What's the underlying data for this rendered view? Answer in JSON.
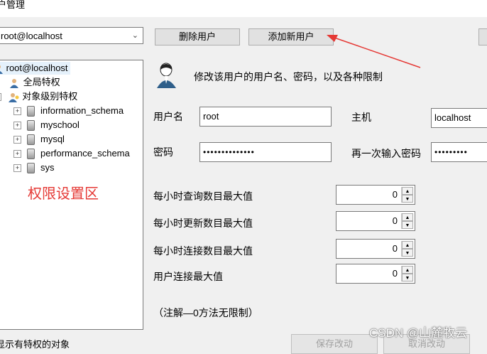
{
  "window": {
    "title": "户管理"
  },
  "account_select": {
    "value": "root@localhost"
  },
  "toolbar": {
    "delete_label": "删除用户",
    "add_label": "添加新用户"
  },
  "tree": {
    "root": "root@localhost",
    "global": "全局特权",
    "object": "对象级别特权",
    "dbs": [
      "information_schema",
      "myschool",
      "mysql",
      "performance_schema",
      "sys"
    ],
    "annotation": "权限设置区"
  },
  "header_text": "修改该用户的用户名、密码，以及各种限制",
  "form": {
    "username_label": "用户名",
    "username_value": "root",
    "host_label": "主机",
    "host_value": "localhost",
    "password_label": "密码",
    "password_value": "••••••••••••••",
    "confirm_label": "再一次输入密码",
    "confirm_value": "•••••••••"
  },
  "limits": [
    {
      "label": "每小时查询数目最大值",
      "value": "0"
    },
    {
      "label": "每小时更新数目最大值",
      "value": "0"
    },
    {
      "label": "每小时连接数目最大值",
      "value": "0"
    },
    {
      "label": "用户连接最大值",
      "value": "0"
    }
  ],
  "note": "（注解—0方法无限制）",
  "footer": {
    "left_text": "显示有特权的对象",
    "save_label": "保存改动",
    "cancel_label": "取消改动"
  },
  "watermark": "CSDN @山麓牧云",
  "colors": {
    "annotation_red": "#e53935",
    "arrow_red": "#e53935"
  }
}
